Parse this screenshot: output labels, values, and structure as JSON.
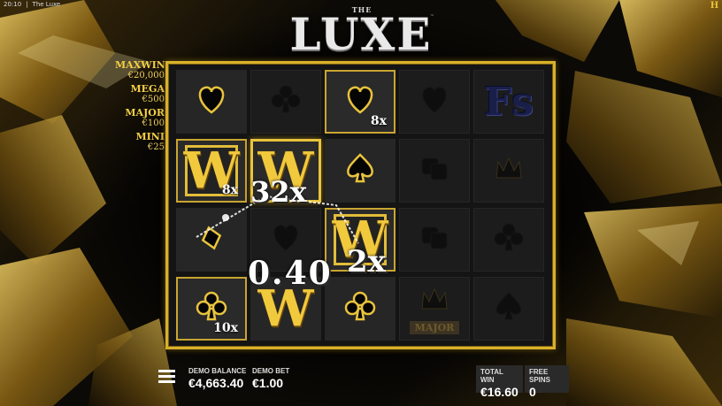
{
  "status_bar": {
    "time": "20:10",
    "app": "The Luxe"
  },
  "title": {
    "the": "THE",
    "main": "LUXE",
    "tm": "™"
  },
  "brand_icon": "H",
  "jackpots": [
    {
      "name": "MAXWIN",
      "value": "€20,000"
    },
    {
      "name": "MEGA",
      "value": "€500"
    },
    {
      "name": "MAJOR",
      "value": "€100"
    },
    {
      "name": "MINI",
      "value": "€25"
    }
  ],
  "grid": {
    "cols": 5,
    "rows": 4,
    "cells": [
      {
        "symbol": "heart",
        "mult": "",
        "style": "lit"
      },
      {
        "symbol": "club-dark",
        "mult": "",
        "style": "dark"
      },
      {
        "symbol": "heart",
        "mult": "8x",
        "style": "gold"
      },
      {
        "symbol": "heart-dark",
        "mult": "",
        "style": "dark"
      },
      {
        "symbol": "fs",
        "text": "Fs",
        "mult": "",
        "style": "dark"
      },
      {
        "symbol": "wild",
        "text": "W",
        "mult": "8x",
        "style": "gold"
      },
      {
        "symbol": "wild",
        "text": "W",
        "mult": "",
        "style": "goldbright"
      },
      {
        "symbol": "spade",
        "mult": "",
        "style": "lit"
      },
      {
        "symbol": "dice-dark",
        "mult": "",
        "style": "dark"
      },
      {
        "symbol": "crown-dark",
        "mult": "",
        "style": "dark"
      },
      {
        "symbol": "diamond",
        "mult": "",
        "style": "lit"
      },
      {
        "symbol": "heart-dark",
        "mult": "",
        "style": "dark"
      },
      {
        "symbol": "wild",
        "text": "W",
        "mult": "",
        "style": "gold"
      },
      {
        "symbol": "dice-dark",
        "mult": "",
        "style": "dark"
      },
      {
        "symbol": "club-dark",
        "mult": "",
        "style": "dark"
      },
      {
        "symbol": "club",
        "mult": "10x",
        "style": "gold"
      },
      {
        "symbol": "wild",
        "text": "W",
        "mult": "",
        "style": "lit"
      },
      {
        "symbol": "club",
        "mult": "",
        "style": "lit"
      },
      {
        "symbol": "major",
        "text": "MAJOR",
        "mult": "",
        "style": "dark"
      },
      {
        "symbol": "spade-dark",
        "mult": "",
        "style": "dark"
      }
    ]
  },
  "overlay": {
    "multiplier_a": "32x",
    "multiplier_b": "2x",
    "line_win": "0.40"
  },
  "bottom": {
    "balance_label": "DEMO BALANCE",
    "balance_value": "€4,663.40",
    "bet_label": "DEMO BET",
    "bet_value": "€1.00",
    "total_win_label": "TOTAL WIN",
    "total_win_value": "€16.60",
    "free_spins_label": "FREE SPINS",
    "free_spins_value": "0"
  },
  "colors": {
    "gold": "#e8c33d",
    "panel": "#2a2a2a",
    "background": "#0b0b0b"
  }
}
